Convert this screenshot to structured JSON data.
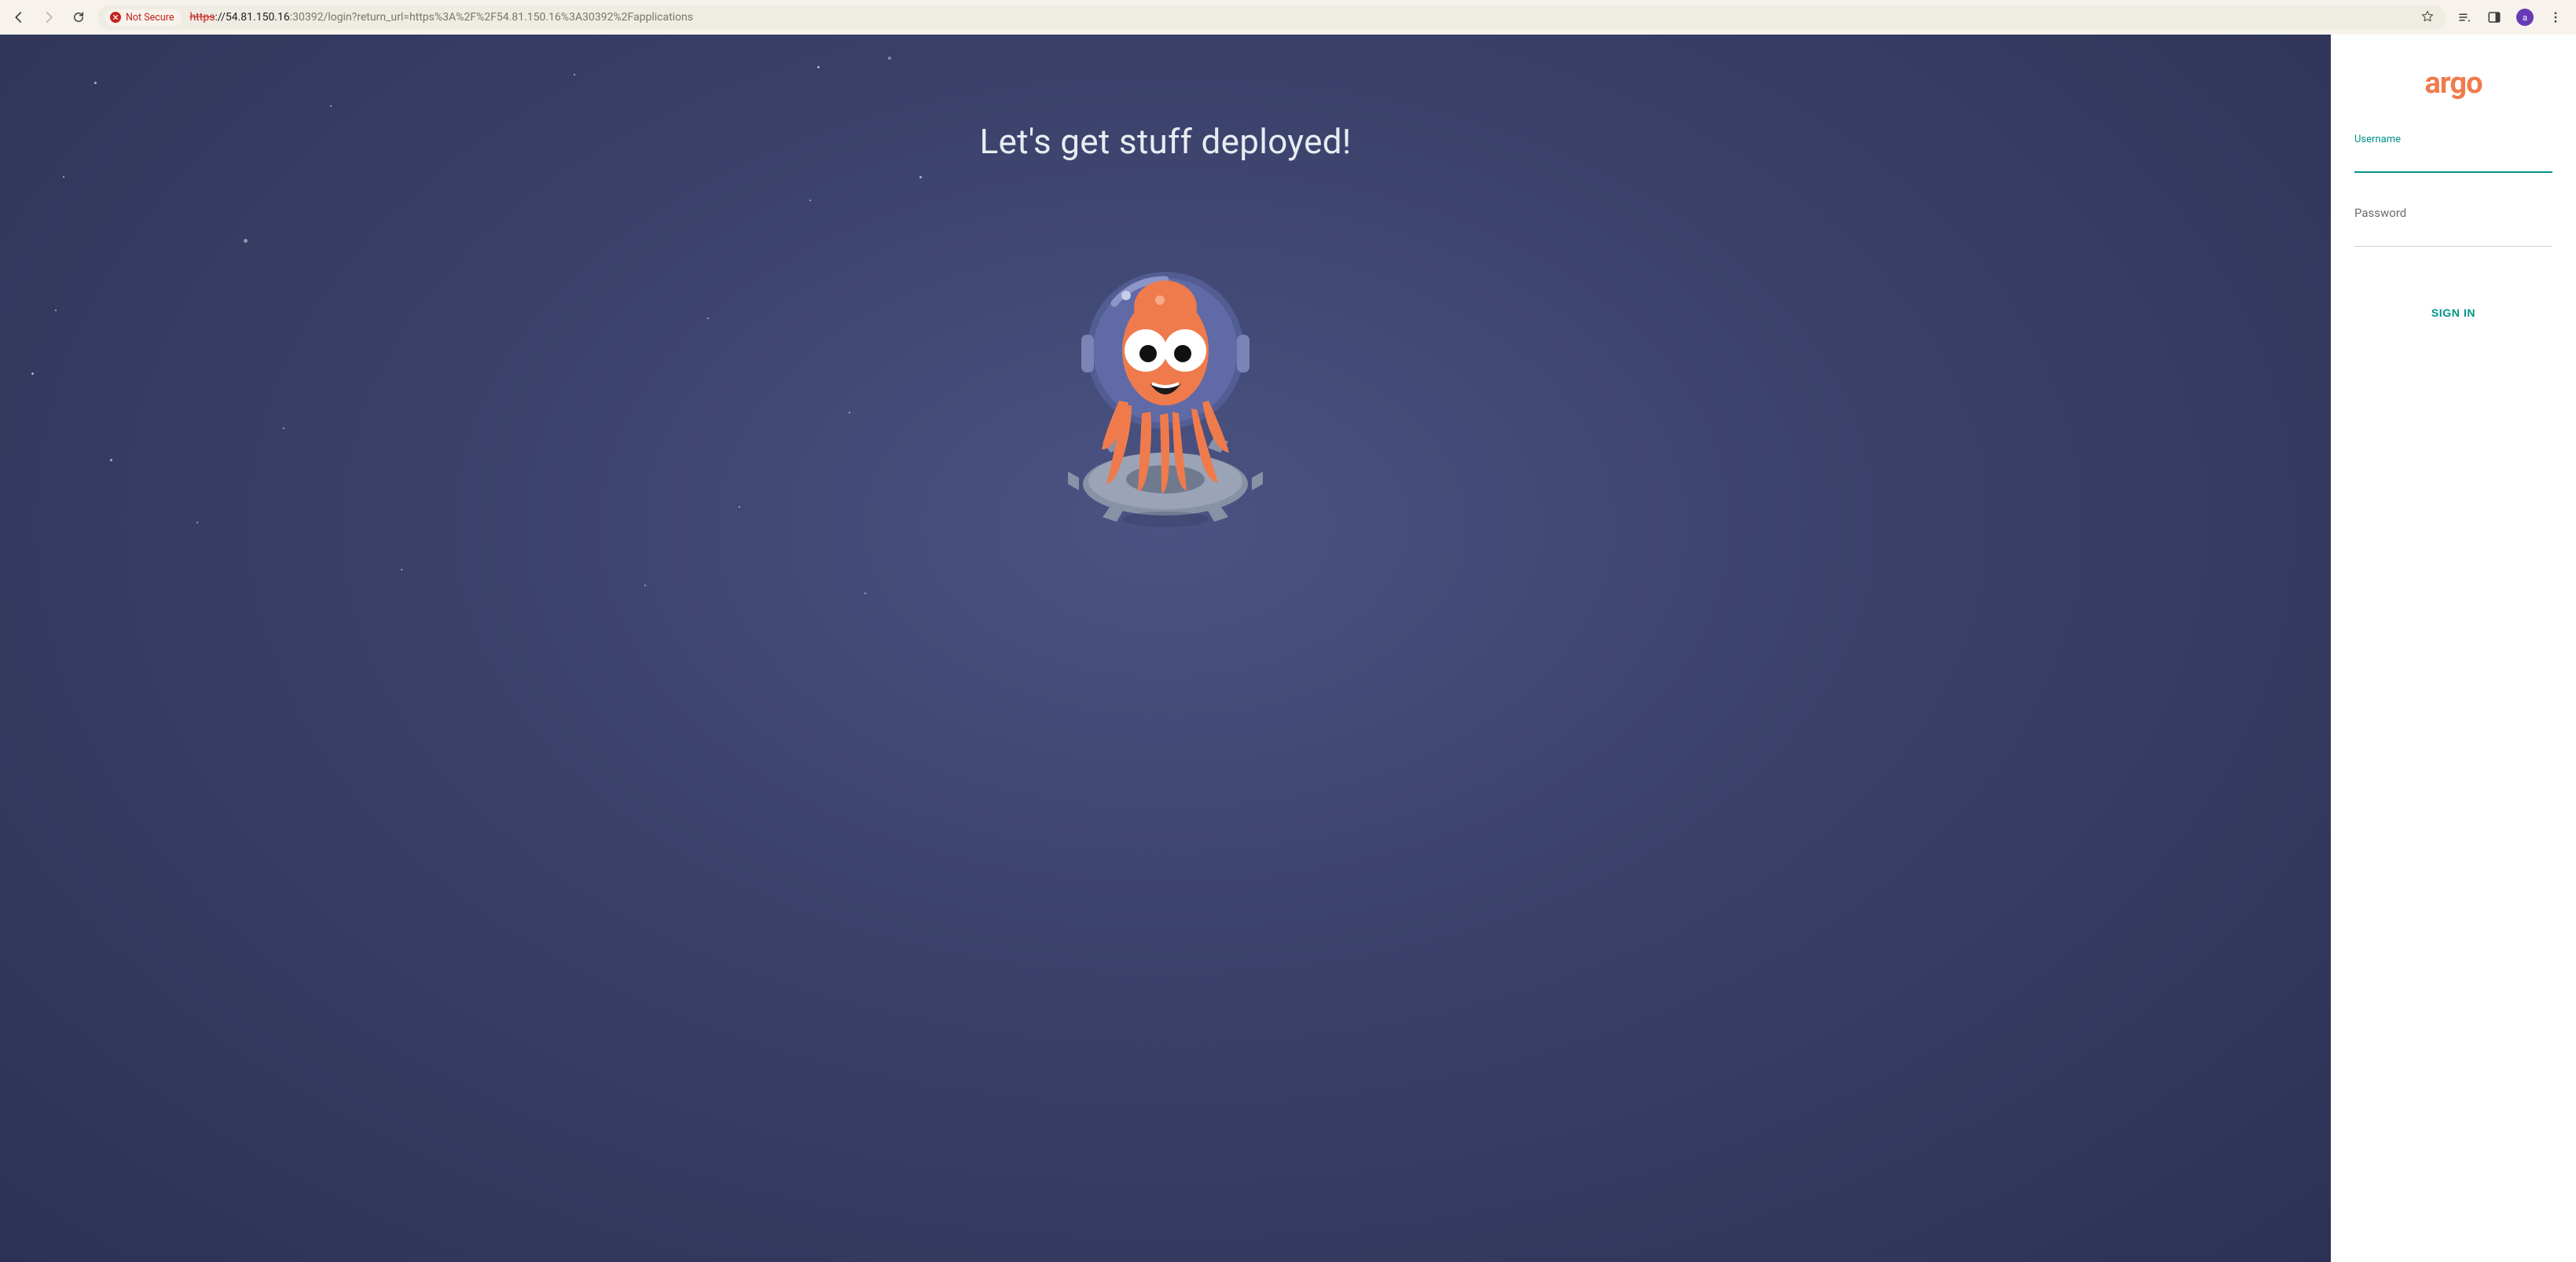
{
  "browser": {
    "security_label": "Not Secure",
    "url_scheme": "https",
    "url_host": "://54.81.150.16",
    "url_port_path": ":30392/login?return_url=https%3A%2F%2F54.81.150.16%3A30392%2Fapplications",
    "avatar_letter": "a"
  },
  "hero": {
    "title": "Let's get stuff deployed!"
  },
  "login": {
    "brand": "argo",
    "username_label": "Username",
    "username_value": "",
    "password_label": "Password",
    "password_value": "",
    "signin_label": "SIGN IN"
  },
  "colors": {
    "accent": "#009485",
    "brand_orange": "#ef7b4d",
    "danger": "#c5221f",
    "space_bg": "#373e63"
  }
}
